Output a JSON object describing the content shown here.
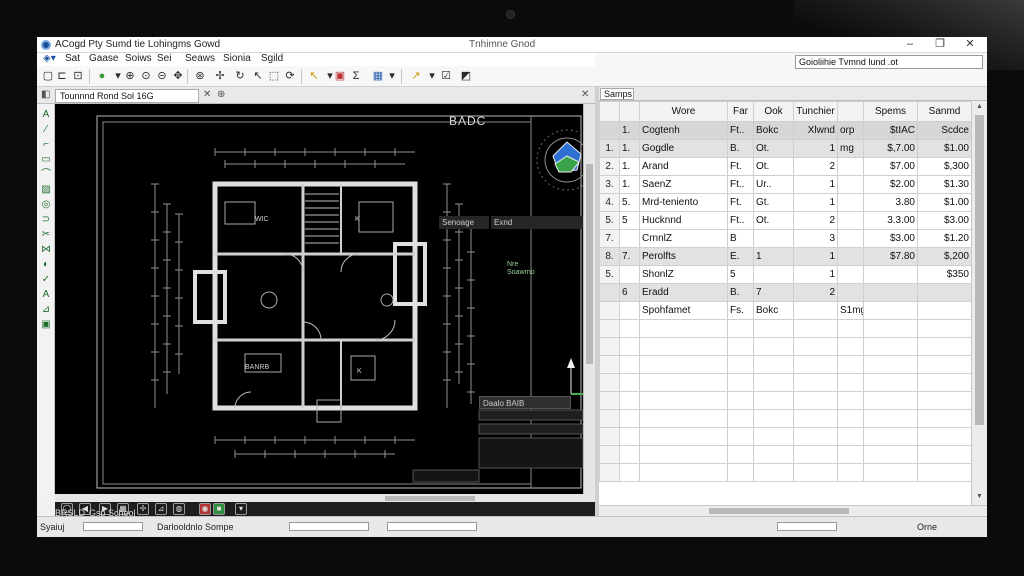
{
  "app": {
    "title": "ACogd Pty  Sumd tie Lohingms Gowd",
    "doc_title": "Tnhimne Gnod",
    "win_minimize": "–",
    "win_maximize": "❐",
    "win_close": "✕"
  },
  "menu": {
    "items": [
      "Sat",
      "Gaase",
      "Soiws",
      "Sei",
      "Seaws",
      "Sionia",
      "Sgild"
    ]
  },
  "right_header": {
    "cell_ref": "Goioliihie Tvmnd lund .ot"
  },
  "cad": {
    "doc_tab": "Tounnnd Rond Sol 16G",
    "tab_add": "⊕",
    "tab_pin": "✕",
    "title_block": "BADC",
    "context_menu": [
      "Senoage",
      "Exnd"
    ],
    "legend": [
      "Nre",
      "Soawrno"
    ],
    "labels": [
      "WIC",
      "K",
      "BANRB",
      "K"
    ],
    "palette_title": "Daalo BAIB"
  },
  "sheet": {
    "tab": "Samps",
    "headers": [
      "",
      "",
      "Wore",
      "Far",
      "Ook",
      "Tunchier",
      "",
      "Spems",
      "Sanmd"
    ],
    "rows": [
      {
        "rn": "",
        "n": "1.",
        "name": "Cogtenh",
        "a": "Ft..",
        "b": "Bokc",
        "c": "Xlwnd",
        "d": "orp",
        "e": "$tIAC",
        "f": "Scdce",
        "style": "sel"
      },
      {
        "rn": "1.",
        "n": "1.",
        "name": "Gogdle",
        "a": "B.",
        "b": "Ot.",
        "c": "1",
        "d": "mg",
        "e": "$,7.00",
        "f": "$1.00",
        "style": "shaded"
      },
      {
        "rn": "2.",
        "n": "1.",
        "name": "Arand",
        "a": "Ft.",
        "b": "Ot.",
        "c": "2",
        "d": "",
        "e": "$7.00",
        "f": "$,300",
        "style": ""
      },
      {
        "rn": "3.",
        "n": "1.",
        "name": "SaenZ",
        "a": "Ft..",
        "b": "Ur..",
        "c": "1",
        "d": "",
        "e": "$2.00",
        "f": "$1.30",
        "style": ""
      },
      {
        "rn": "4.",
        "n": "5.",
        "name": "Mrd-teniento",
        "a": "Ft.",
        "b": "Gt.",
        "c": "1",
        "d": "",
        "e": "3.80",
        "f": "$1.00",
        "style": ""
      },
      {
        "rn": "5.",
        "n": "5",
        "name": "Hucknnd",
        "a": "Ft..",
        "b": "Ot.",
        "c": "2",
        "d": "",
        "e": "3.3.00",
        "f": "$3.00",
        "style": ""
      },
      {
        "rn": "7.",
        "n": "",
        "name": "CrnnlZ",
        "a": "B",
        "b": "",
        "c": "3",
        "d": "",
        "e": "$3.00",
        "f": "$1.20",
        "style": ""
      },
      {
        "rn": "8.",
        "n": "7.",
        "name": "Perolfts",
        "a": "E.",
        "b": "1",
        "c": "1",
        "d": "",
        "e": "$7.80",
        "f": "$,200",
        "style": "shaded"
      },
      {
        "rn": "5.",
        "n": "",
        "name": "ShonlZ",
        "a": "5",
        "b": "",
        "c": "1",
        "d": "",
        "e": "",
        "f": "$350",
        "style": ""
      },
      {
        "rn": "",
        "n": "6",
        "name": "Eradd",
        "a": "B.",
        "b": "7",
        "c": "2",
        "d": "",
        "e": "",
        "f": "",
        "style": "shaded"
      },
      {
        "rn": "",
        "n": "",
        "name": "Spohfamet",
        "a": "Fs.",
        "b": "Bokc",
        "c": "",
        "d": "S1mg",
        "e": "",
        "f": "",
        "style": ""
      }
    ]
  },
  "status": {
    "left": "Syaiuj",
    "model": "BRSLD",
    "layout": "Gsp Scheol",
    "center": "Darlooldnlo Sompe",
    "right": "Orne"
  }
}
